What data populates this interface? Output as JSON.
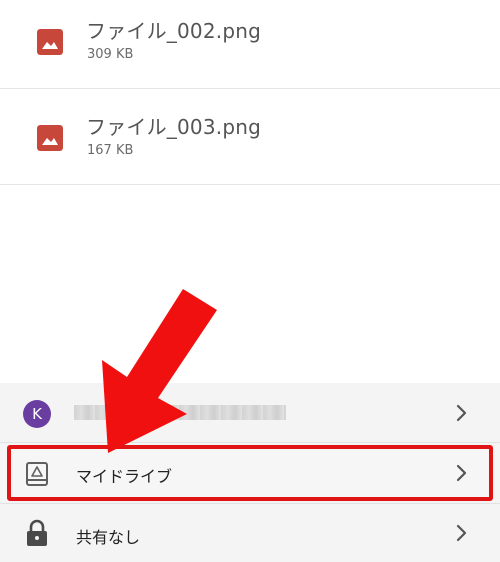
{
  "files": [
    {
      "name": "ファイル_002.png",
      "size": "309 KB",
      "icon": "image-file-icon"
    },
    {
      "name": "ファイル_003.png",
      "size": "167 KB",
      "icon": "image-file-icon"
    }
  ],
  "sheet": {
    "account": {
      "avatar_letter": "K",
      "avatar_color": "#6a3ea1",
      "chevron": "chevron-right-icon"
    },
    "my_drive": {
      "label": "マイドライブ",
      "icon": "drive-folder-icon",
      "chevron": "chevron-right-icon"
    },
    "sharing": {
      "label": "共有なし",
      "icon": "lock-icon",
      "chevron": "chevron-right-icon"
    }
  },
  "colors": {
    "file_icon": "#c8473b",
    "highlight": "#e01414",
    "arrow": "#f01010"
  }
}
